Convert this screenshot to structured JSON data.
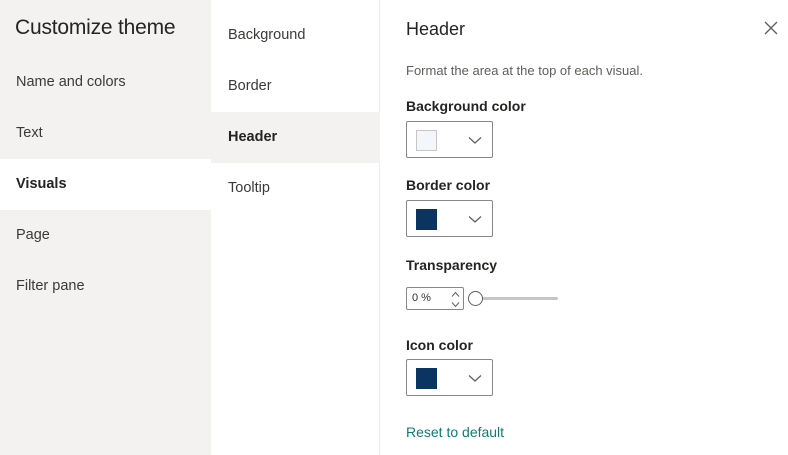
{
  "sidebar": {
    "title": "Customize theme",
    "items": [
      {
        "label": "Name and colors"
      },
      {
        "label": "Text"
      },
      {
        "label": "Visuals"
      },
      {
        "label": "Page"
      },
      {
        "label": "Filter pane"
      }
    ]
  },
  "subnav": {
    "items": [
      {
        "label": "Background"
      },
      {
        "label": "Border"
      },
      {
        "label": "Header"
      },
      {
        "label": "Tooltip"
      }
    ]
  },
  "panel": {
    "title": "Header",
    "description": "Format the area at the top of each visual.",
    "background_color": {
      "label": "Background color",
      "swatch": "#f3f6fa"
    },
    "border_color": {
      "label": "Border color",
      "swatch": "#0c3461"
    },
    "transparency": {
      "label": "Transparency",
      "value": "0 %",
      "level": 0
    },
    "icon_color": {
      "label": "Icon color",
      "swatch": "#0c3461"
    },
    "reset_label": "Reset to default"
  }
}
